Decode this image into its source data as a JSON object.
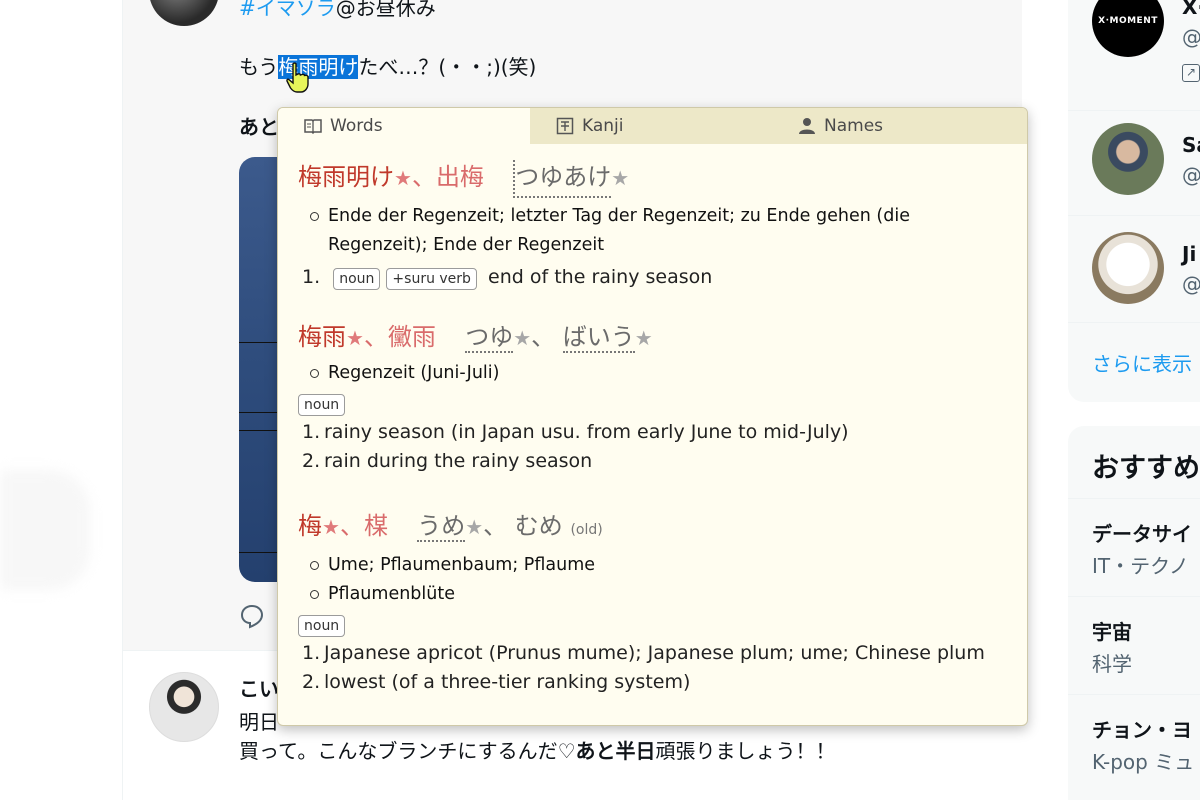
{
  "timeline": {
    "post1": {
      "hashtag": "#イマソラ",
      "hashtag_suffix": "@お昼休み",
      "text_before": "もう",
      "text_selected": "梅雨明け",
      "text_after": "たべ…？(・・;)(笑)",
      "bold_start": "あと"
    },
    "post2": {
      "name_start": "こい",
      "line1": "明日",
      "line2_text": "買って。こんなブランチにするんだ♡",
      "line2_bold": "あと半日",
      "line2_end": "頑張りましょう！！"
    }
  },
  "sidebar": {
    "accounts": [
      {
        "name": "X·",
        "handle": "@",
        "avatar_text": "X·MOMENT"
      },
      {
        "name": "Sa",
        "handle": "@"
      },
      {
        "name": "Ji",
        "handle": "@"
      }
    ],
    "show_more": "さらに表示",
    "trends_title": "おすすめ",
    "trends": [
      {
        "name": "データサイ",
        "category": "IT・テクノ"
      },
      {
        "name": "宇宙",
        "category": "科学"
      },
      {
        "name": "チョン・ヨ",
        "category": "K-pop ミュ"
      }
    ]
  },
  "popup": {
    "tabs": [
      {
        "label": "Words",
        "icon": "book-icon",
        "active": true
      },
      {
        "label": "Kanji",
        "icon": "kanji-icon",
        "active": false
      },
      {
        "label": "Names",
        "icon": "person-icon",
        "active": false
      }
    ],
    "entries": [
      {
        "kanji": [
          "梅雨明け",
          "出梅"
        ],
        "kana": "つゆあけ",
        "german": [
          "Ende der Regenzeit; letzter Tag der Regenzeit; zu Ende gehen (die Regenzeit); Ende der Regenzeit"
        ],
        "pos": [
          "noun",
          "+suru verb"
        ],
        "senses": [
          "end of the rainy season"
        ]
      },
      {
        "kanji": [
          "梅雨",
          "黴雨"
        ],
        "kana": [
          "つゆ",
          "ばいう"
        ],
        "german": [
          "Regenzeit (Juni-Juli)"
        ],
        "pos": [
          "noun"
        ],
        "senses": [
          "rainy season (in Japan usu. from early June to mid-July)",
          "rain during the rainy season"
        ]
      },
      {
        "kanji": [
          "梅",
          "楳"
        ],
        "kana": [
          "うめ",
          "むめ"
        ],
        "old_label": "(old)",
        "german": [
          "Ume; Pflaumenbaum; Pflaume",
          "Pflaumenblüte"
        ],
        "pos": [
          "noun"
        ],
        "senses": [
          "Japanese apricot (Prunus mume); Japanese plum; ume; Chinese plum",
          "lowest (of a three-tier ranking system)"
        ]
      }
    ]
  },
  "colors": {
    "link": "#1d9bf0",
    "selection": "#0a74d9",
    "popup_bg": "#fffdf0",
    "tab_bar": "#ede8c8",
    "headword": "#c0392b"
  }
}
